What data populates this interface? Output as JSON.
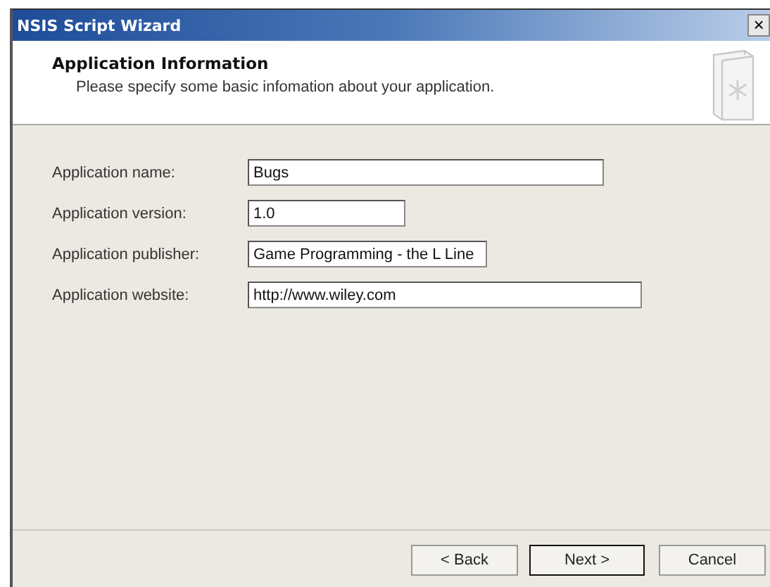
{
  "window": {
    "title": "NSIS Script Wizard",
    "close": "×"
  },
  "header": {
    "title": "Application Information",
    "subtitle": "Please specify some basic infomation about your application."
  },
  "fields": [
    {
      "label": "Application name:",
      "value": "Bugs"
    },
    {
      "label": "Application version:",
      "value": "1.0"
    },
    {
      "label": "Application publisher:",
      "value": "Game Programming - the L Line"
    },
    {
      "label": "Application website:",
      "value": "http://www.wiley.com"
    }
  ],
  "buttons": [
    {
      "label": "< Back",
      "default": false
    },
    {
      "label": "Next >",
      "default": true
    },
    {
      "label": "Cancel",
      "default": false
    }
  ]
}
